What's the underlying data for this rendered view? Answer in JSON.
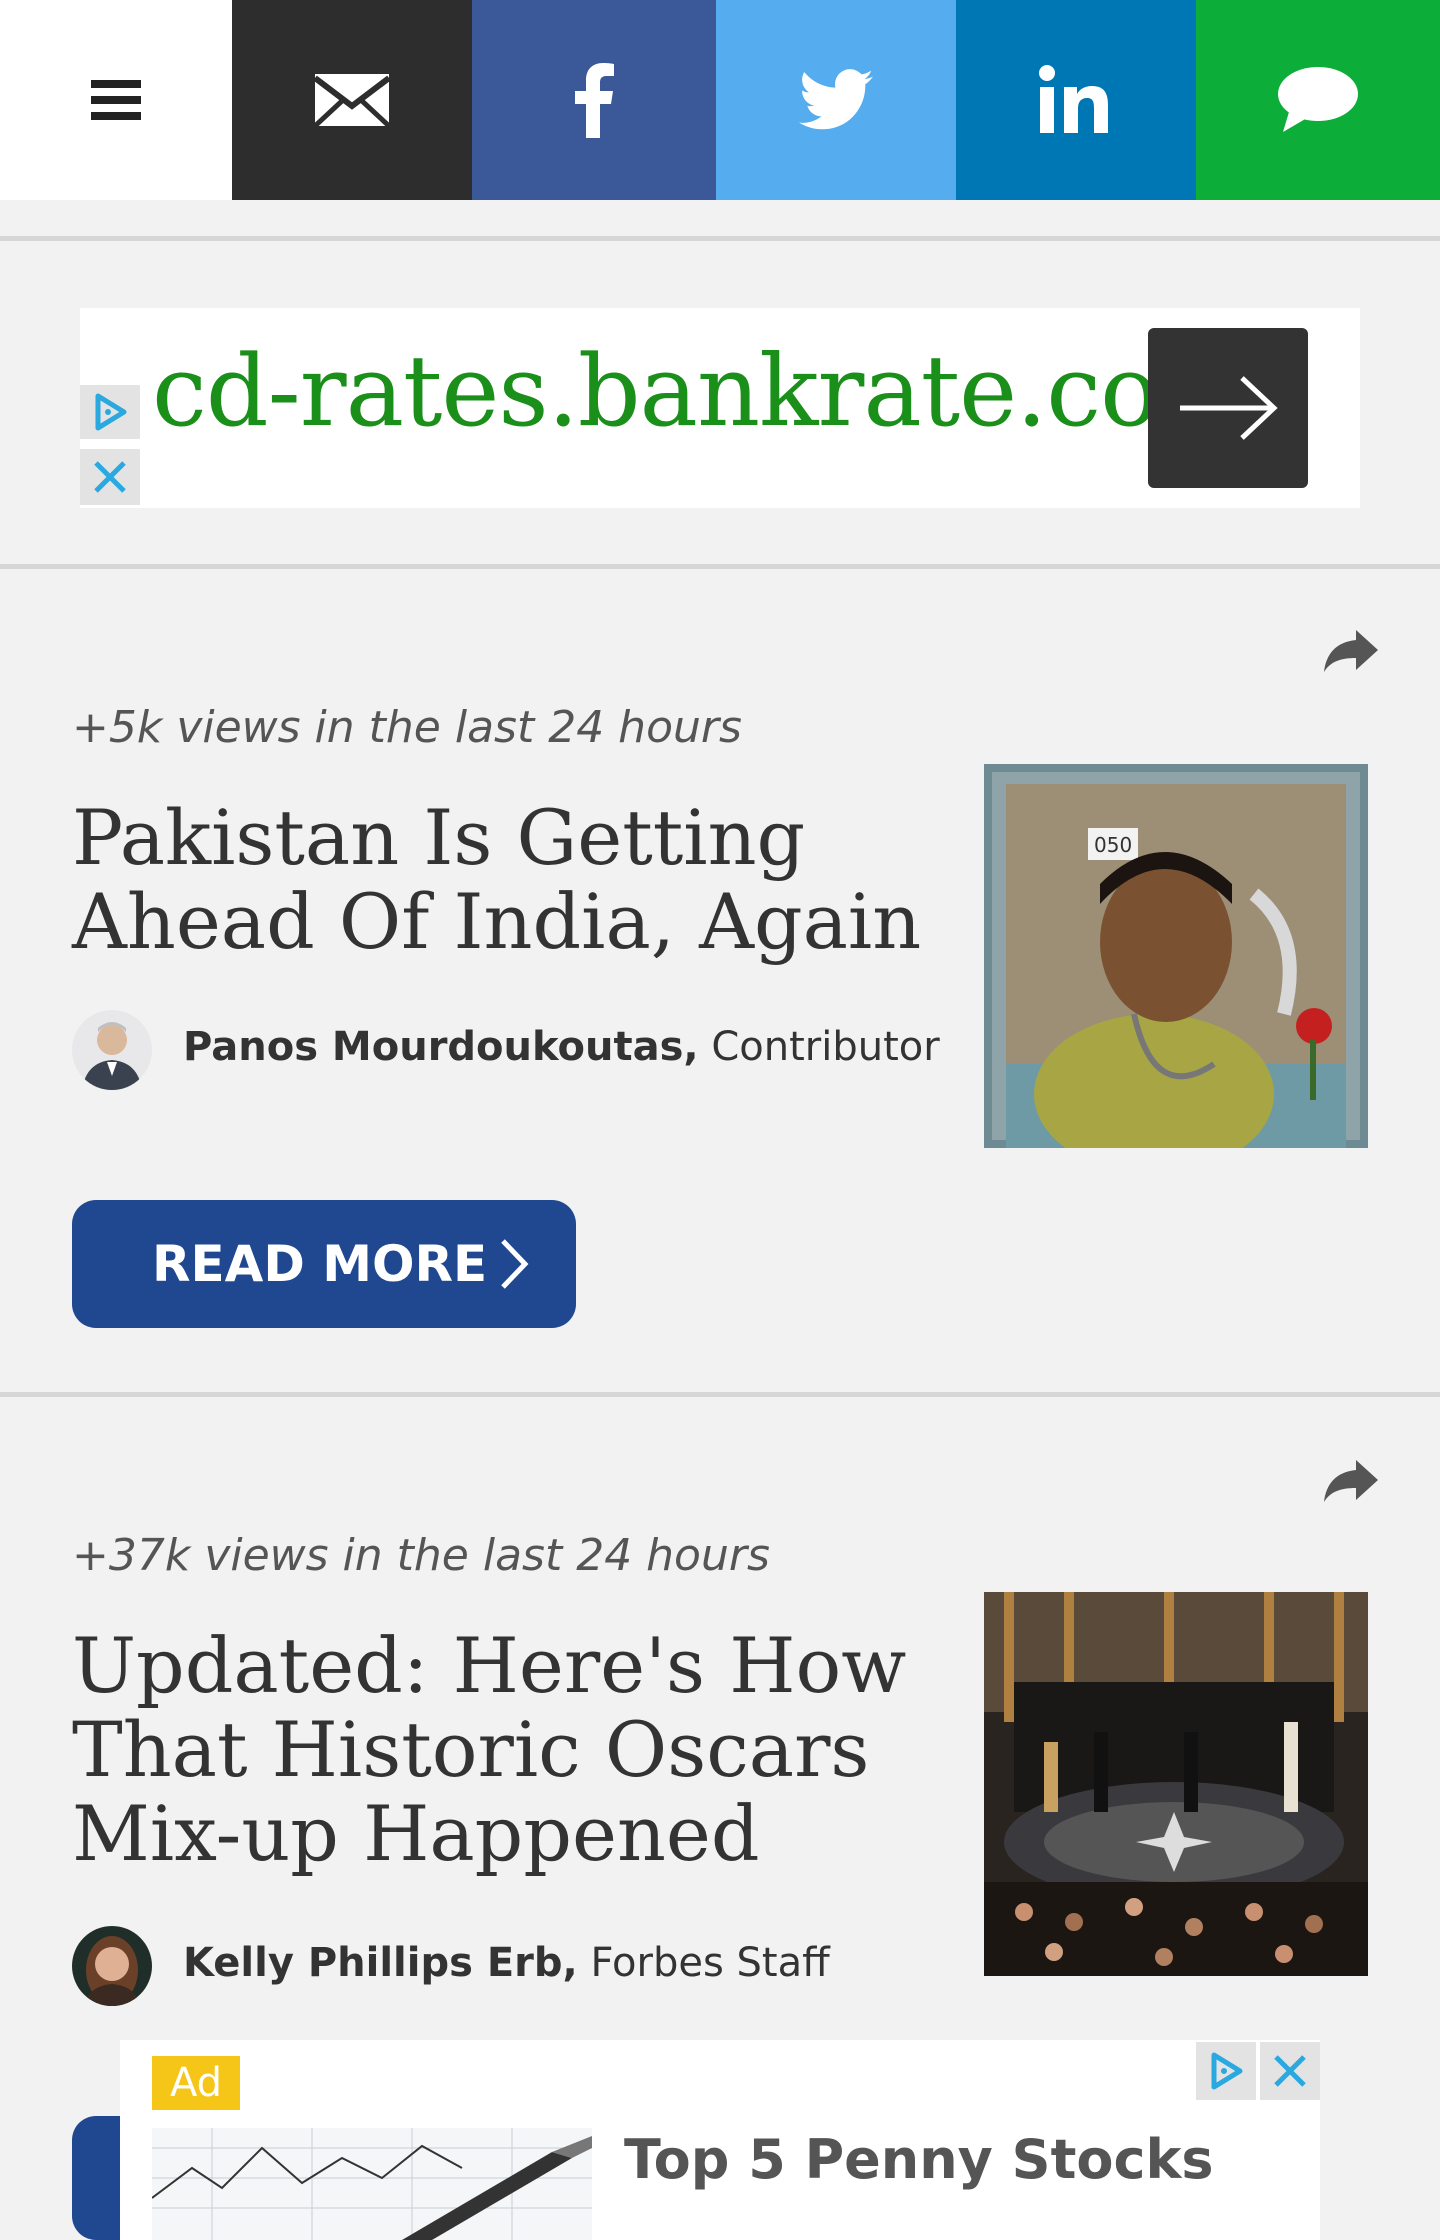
{
  "share_bar": {
    "icons": [
      "menu-icon",
      "email-icon",
      "facebook-icon",
      "twitter-icon",
      "linkedin-icon",
      "sms-icon"
    ],
    "colors": {
      "email": "#2d2d2d",
      "facebook": "#3b5998",
      "twitter": "#55acee",
      "linkedin": "#0077b5",
      "sms": "#0dad39"
    }
  },
  "ad_banner": {
    "url_text": "cd-rates.bankrate.com",
    "url_color": "#1a8f1a"
  },
  "articles": [
    {
      "views": "+5k views in the last 24 hours",
      "title": "Pakistan Is Getting Ahead Of India, Again",
      "author": "Panos Mourdoukoutas,",
      "role": "Contributor",
      "read_more": "READ MORE"
    },
    {
      "views": "+37k views in the last 24 hours",
      "title": "Updated: Here's How That Historic Oscars Mix-up Happened",
      "author": "Kelly Phillips Erb,",
      "role": "Forbes Staff"
    }
  ],
  "bottom_ad": {
    "badge": "Ad",
    "title": "Top 5 Penny Stocks"
  },
  "accent_color": "#1f4891"
}
